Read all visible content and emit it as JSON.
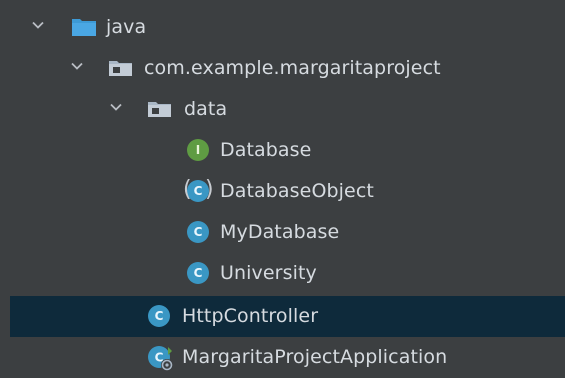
{
  "tree": {
    "items": [
      {
        "label": "java",
        "icon": "folder-icon",
        "expanded": true
      },
      {
        "label": "com.example.margaritaproject",
        "icon": "package-icon",
        "expanded": true
      },
      {
        "label": "data",
        "icon": "package-icon",
        "expanded": true
      },
      {
        "label": "Database",
        "icon": "interface-icon",
        "badge": "I"
      },
      {
        "label": "DatabaseObject",
        "icon": "abstract-class-icon",
        "badge": "C"
      },
      {
        "label": "MyDatabase",
        "icon": "class-icon",
        "badge": "C"
      },
      {
        "label": "University",
        "icon": "class-icon",
        "badge": "C"
      },
      {
        "label": "HttpController",
        "icon": "class-icon",
        "badge": "C",
        "selected": true
      },
      {
        "label": "MargaritaProjectApplication",
        "icon": "spring-application-class-icon",
        "badge": "C"
      }
    ]
  },
  "colors": {
    "background": "#3c3f41",
    "selection": "#0e2a3b",
    "text": "#d6dbe0",
    "folder_blue": "#3d9ad6",
    "class_blue": "#3a97c4",
    "interface_green": "#5f9c43"
  }
}
